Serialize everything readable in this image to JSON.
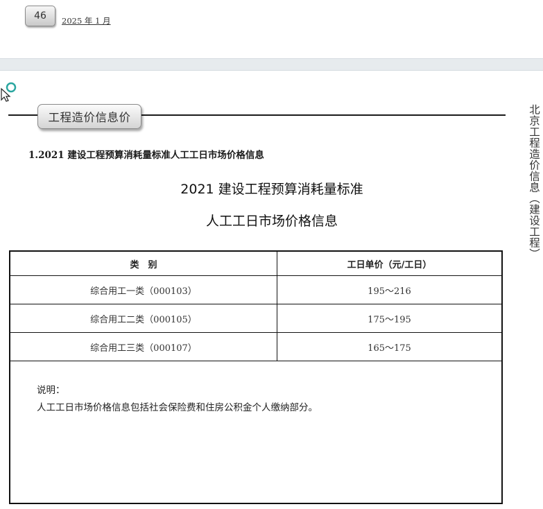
{
  "header": {
    "page_number": "46",
    "issue_date": "2025 年 1 月"
  },
  "section_tab": "工程造价信息价",
  "side_title": "北京工程造价信息（建设工程）",
  "sub_heading": "1.2021 建设工程预算消耗量标准人工工日市场价格信息",
  "title": {
    "line1": "2021 建设工程预算消耗量标准",
    "line2": "人工工日市场价格信息"
  },
  "table": {
    "headers": [
      "类　别",
      "工日单价（元/工日）"
    ],
    "rows": [
      [
        "综合用工一类（000103）",
        "195～216"
      ],
      [
        "综合用工二类（000105）",
        "175～195"
      ],
      [
        "综合用工三类（000107）",
        "165～175"
      ]
    ]
  },
  "note": {
    "label": "说明：",
    "text": "人工工日市场价格信息包括社会保险费和住房公积金个人缴纳部分。"
  },
  "icons": {
    "cursor": "pointer-with-search-ring-icon"
  }
}
